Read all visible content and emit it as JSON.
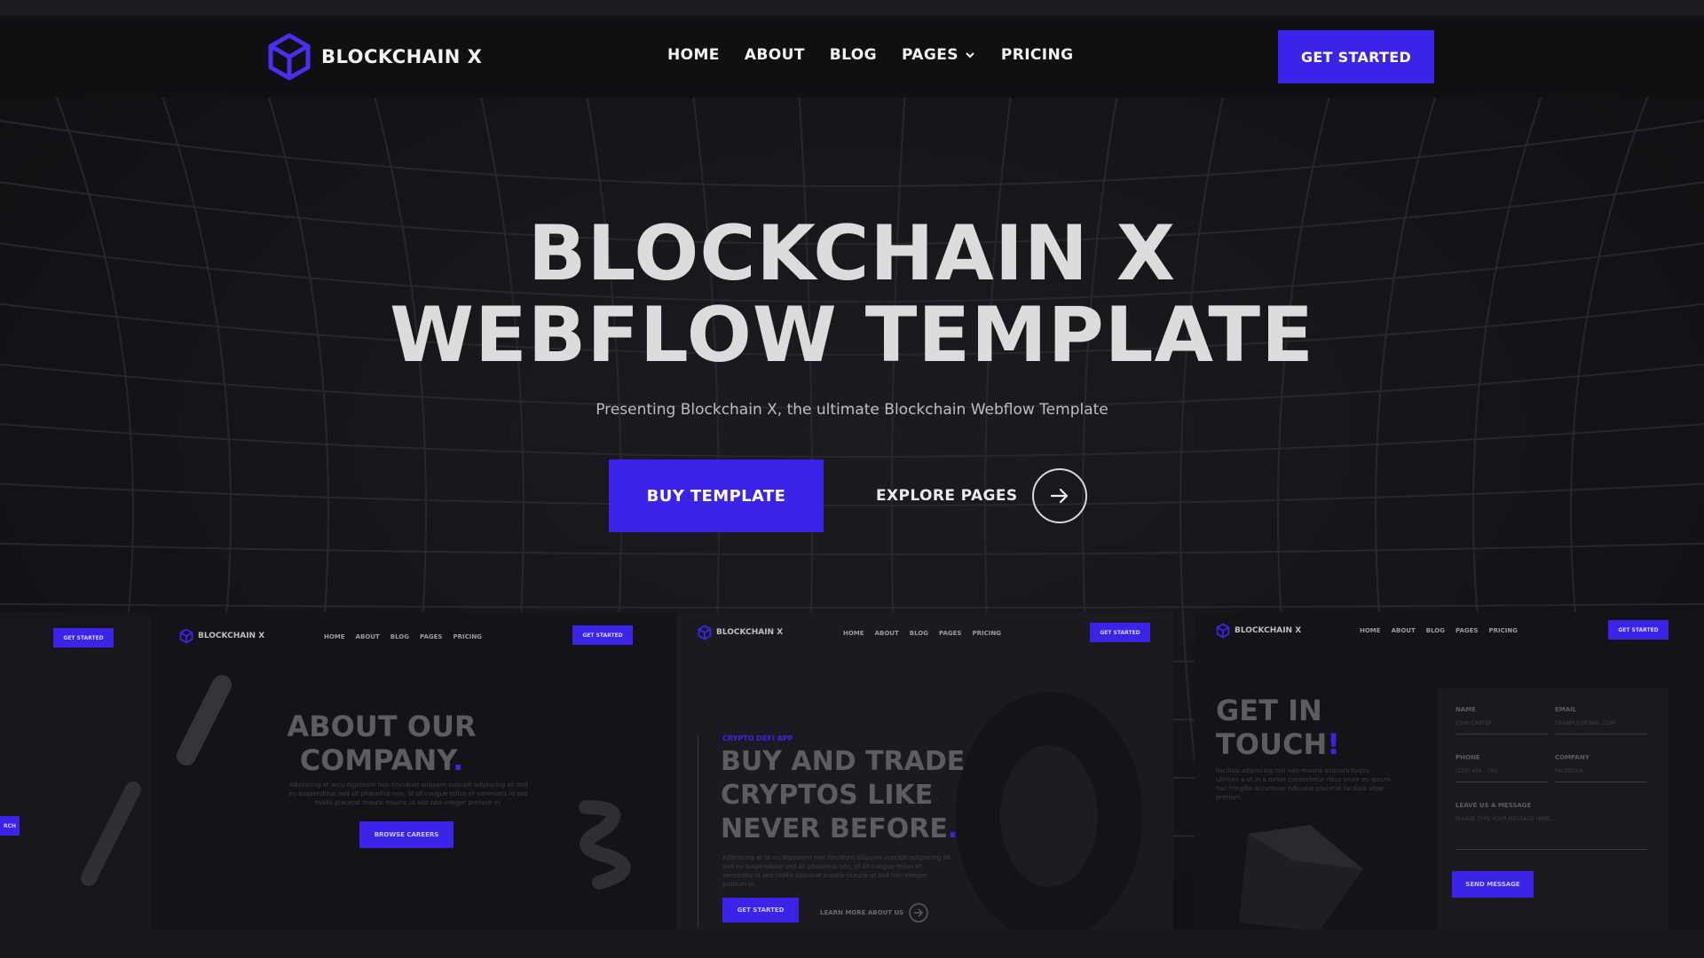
{
  "brand": {
    "name": "BLOCKCHAIN X",
    "accent": "#3b24e8"
  },
  "nav": {
    "items": [
      "HOME",
      "ABOUT",
      "BLOG",
      "PAGES",
      "PRICING"
    ],
    "cta": "GET STARTED"
  },
  "hero": {
    "title_line1": "BLOCKCHAIN X",
    "title_line2": "WEBFLOW TEMPLATE",
    "subtitle": "Presenting Blockchain X, the ultimate Blockchain Webflow Template",
    "buy_label": "BUY TEMPLATE",
    "explore_label": "EXPLORE PAGES"
  },
  "previews": {
    "left_cta": "GET STARTED",
    "about": {
      "brand": "BLOCKCHAIN X",
      "menu": [
        "HOME",
        "ABOUT",
        "BLOG",
        "PAGES",
        "PRICING"
      ],
      "cta": "GET STARTED",
      "heading_line1": "ABOUT OUR",
      "heading_line2": "COMPANY",
      "para": "Adipiscing at arcu dignissim non tincidunt aliquam suscipit adipiscing sit sed eu suspendisse sed sit phasellus non, id sit congue tellus et venenatis id sed mollis placerat mauris mauris ut sed non integer pretium in.",
      "button": "BROWSE CAREERS",
      "side_btn": "RCH"
    },
    "trade": {
      "brand": "BLOCKCHAIN X",
      "menu": [
        "HOME",
        "ABOUT",
        "BLOG",
        "PAGES",
        "PRICING"
      ],
      "cta": "GET STARTED",
      "eyebrow": "CRYPTO DEFI APP",
      "heading_line1": "BUY AND TRADE",
      "heading_line2": "CRYPTOS LIKE",
      "heading_line3": "NEVER BEFORE",
      "para": "Adipiscing at at eu dignissim non tincidunt aliquam suscipit adipiscing sit sed eu suspendisse sed sit phasellus non, id sit congue tellus et venenatis id sed mollis placerat mauris mauris ut sed non integer pretium in.",
      "button": "GET STARTED",
      "learn": "LEARN MORE ABOUT US"
    },
    "contact": {
      "brand": "BLOCKCHAIN X",
      "menu": [
        "HOME",
        "ABOUT",
        "BLOG",
        "PAGES",
        "PRICING"
      ],
      "cta": "GET STARTED",
      "heading_line1": "GET IN",
      "heading_line2": "TOUCH",
      "para": "Facilisis adipiscing nisi non mauris aliquam turpis ultrices a ut in a tortor consectetur risus orum eu ipsum hac fringilla accumsan ridiculus placerat facilisis vitae pretium.",
      "name_label": "NAME",
      "name_ph": "JOHN CARTER",
      "email_label": "EMAIL",
      "email_ph": "EXAMPLE@EMAIL.COM",
      "phone_label": "PHONE",
      "phone_ph": "(123) 456 - 789",
      "company_label": "COMPANY",
      "company_ph": "FACEBOOK",
      "message_label": "LEAVE US A MESSAGE",
      "message_ph": "PLEASE TYPE YOUR MESSAGE HERE...",
      "send": "SEND MESSAGE"
    }
  }
}
